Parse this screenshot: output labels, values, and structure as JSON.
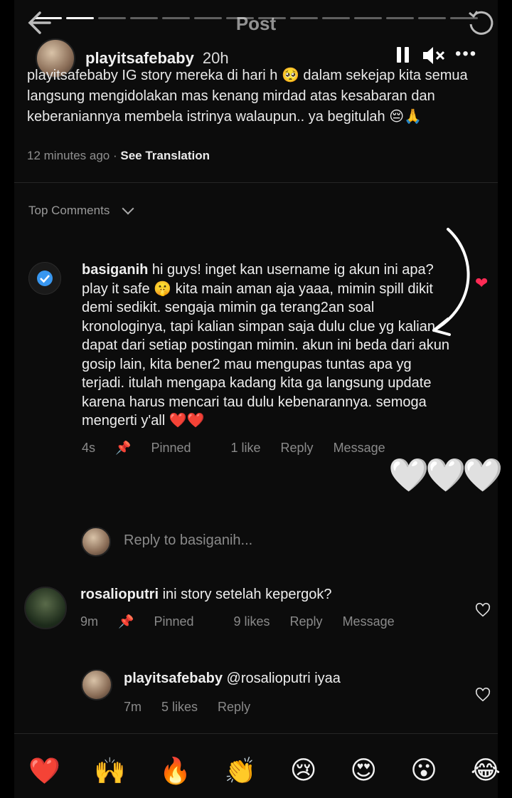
{
  "header": {
    "title": "Post",
    "story_user": "playitsafebaby",
    "story_time": "20h",
    "caption": "playitsafebaby IG story mereka di hari h 🥺 dalam sekejap kita semua langsung mengidolakan mas kenang mirdad atas kesabaran dan keberaniannya membela istrinya walaupun.. ya begitulah 😔🙏",
    "caption_time": "12 minutes ago",
    "see_translation": "See Translation"
  },
  "comments_header": {
    "label": "Top Comments"
  },
  "comment1": {
    "user": "basiganih",
    "text": "hi guys! inget kan username ig akun ini apa? play it safe 🤫 kita main aman aja yaaa, mimin spill dikit demi sedikit. sengaja mimin ga terang2an soal kronologinya, tapi kalian simpan saja dulu clue yg kalian dapat dari setiap postingan mimin. akun ini beda dari akun gosip lain, kita bener2 mau mengupas tuntas apa yg terjadi. itulah mengapa kadang kita ga langsung update karena harus mencari tau dulu kebenarannya. semoga mengerti y'all ❤️❤️",
    "time": "4s",
    "pinned": "Pinned",
    "likes": "1 like",
    "reply": "Reply",
    "message": "Message"
  },
  "reply_box": {
    "placeholder": "Reply to basiganih..."
  },
  "comment2": {
    "user": "rosalioputri",
    "text": "ini story setelah kepergok?",
    "time": "9m",
    "pinned": "Pinned",
    "likes": "9 likes",
    "reply": "Reply",
    "message": "Message"
  },
  "comment3": {
    "user": "playitsafebaby",
    "text": "@rosalioputri iyaa",
    "time": "7m",
    "likes": "5 likes",
    "reply": "Reply"
  },
  "overlay": {
    "hearts": [
      "🤍",
      "🤍",
      "🤍"
    ],
    "red_heart": "❤"
  },
  "emoji_bar": [
    "❤️",
    "🙌",
    "🔥",
    "👏",
    "😢",
    "😍",
    "😮",
    "😂"
  ]
}
